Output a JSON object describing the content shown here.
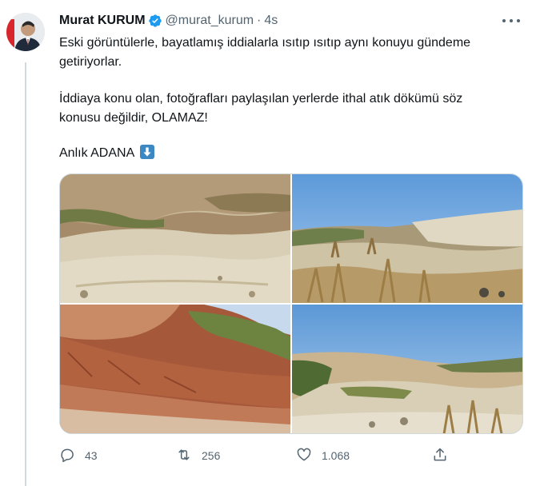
{
  "tweet": {
    "author_name": "Murat KURUM",
    "author_handle": "@murat_kurum",
    "separator": "·",
    "time": "4s",
    "text_lines": [
      "Eski görüntülerle, bayatlamış iddialarla ısıtıp ısıtıp aynı konuyu gündeme getiriyorlar.",
      "İddiaya konu olan, fotoğrafları paylaşılan yerlerde ithal atık dökümü söz konusu değildir, OLAMAZ!",
      "Anlık ADANA"
    ],
    "emoji": "down-arrow-emoji",
    "media_count": 4
  },
  "actions": {
    "replies": "43",
    "retweets": "256",
    "likes": "1.068"
  },
  "icons": {
    "verified": "verified-badge-icon",
    "more": "more-dots-icon",
    "reply": "reply-icon",
    "retweet": "retweet-icon",
    "like": "heart-icon",
    "share": "share-icon"
  },
  "colors": {
    "verified_blue": "#1d9bf0",
    "secondary_text": "#536471",
    "primary_text": "#0f1419",
    "border": "#cfd9de"
  }
}
